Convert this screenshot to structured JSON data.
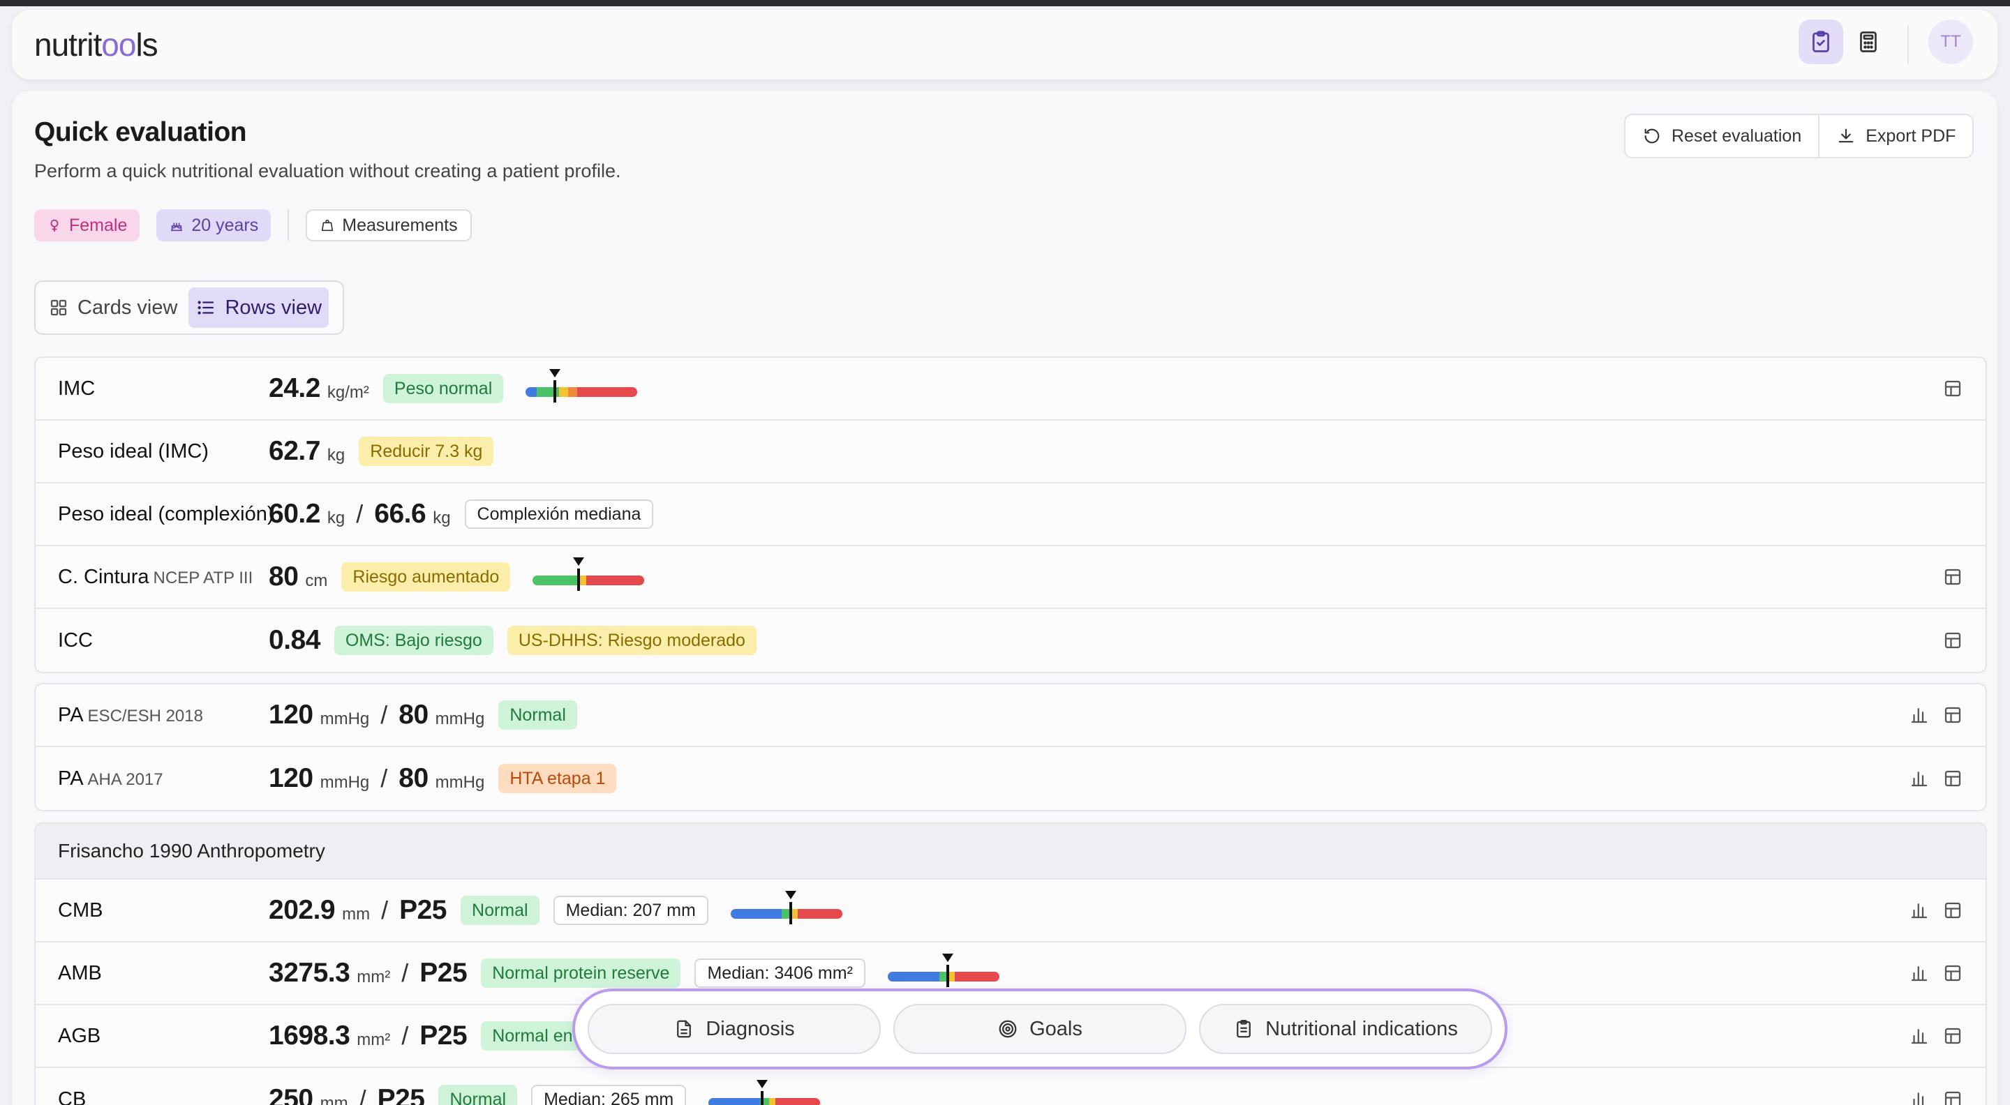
{
  "app": {
    "logo_prefix": "nutrit",
    "logo_oo": "oo",
    "logo_suffix": "ls",
    "avatar": "TT",
    "header_icons": [
      "clipboard-check-icon",
      "calculator-icon"
    ]
  },
  "page": {
    "title": "Quick evaluation",
    "subtitle": "Perform a quick nutritional evaluation without creating a patient profile.",
    "reset_label": "Reset evaluation",
    "export_label": "Export PDF"
  },
  "patient": {
    "sex": "Female",
    "age": "20 years",
    "measurements": "Measurements"
  },
  "views": {
    "cards": "Cards view",
    "rows": "Rows view",
    "active": "rows"
  },
  "colors": {
    "accent": "#8b6bd8",
    "green": "#4cc268",
    "yellow": "#f2c230",
    "orange": "#f08a3a",
    "red": "#e5484d",
    "blue": "#3f7be0"
  },
  "group1": [
    {
      "label": "IMC",
      "value": "24.2",
      "unit": "kg/m²",
      "tags": [
        {
          "text": "Peso normal",
          "color": "green"
        }
      ],
      "gauge": {
        "type": "bmi",
        "level": 0.26
      },
      "icons": [
        "table"
      ]
    },
    {
      "label": "Peso ideal (IMC)",
      "value": "62.7",
      "unit": "kg",
      "tags": [
        {
          "text": "Reducir 7.3 kg",
          "color": "yellow"
        }
      ]
    },
    {
      "label": "Peso ideal (complexión)",
      "value": "60.2",
      "unit": "kg",
      "value2": "66.6",
      "unit2": "kg",
      "tags": [
        {
          "text": "Complexión mediana",
          "color": "outline"
        }
      ]
    },
    {
      "label": "C. Cintura",
      "sublabel": "NCEP ATP III",
      "value": "80",
      "unit": "cm",
      "tags": [
        {
          "text": "Riesgo aumentado",
          "color": "yellow"
        }
      ],
      "gauge": {
        "type": "waist",
        "level": 0.41
      },
      "icons": [
        "table"
      ]
    },
    {
      "label": "ICC",
      "value": "0.84",
      "tags": [
        {
          "text": "OMS: Bajo riesgo",
          "color": "green"
        },
        {
          "text": "US-DHHS: Riesgo moderado",
          "color": "yellow"
        }
      ],
      "icons": [
        "table"
      ]
    }
  ],
  "group2": [
    {
      "label": "PA",
      "sublabel": "ESC/ESH 2018",
      "value": "120",
      "unit": "mmHg",
      "value2": "80",
      "unit2": "mmHg",
      "tags": [
        {
          "text": "Normal",
          "color": "green"
        }
      ],
      "icons": [
        "chart",
        "table"
      ]
    },
    {
      "label": "PA",
      "sublabel": "AHA 2017",
      "value": "120",
      "unit": "mmHg",
      "value2": "80",
      "unit2": "mmHg",
      "tags": [
        {
          "text": "HTA etapa 1",
          "color": "orange"
        }
      ],
      "icons": [
        "chart",
        "table"
      ]
    }
  ],
  "group3": {
    "title": "Frisancho 1990 Anthropometry",
    "rows": [
      {
        "label": "CMB",
        "value": "202.9",
        "unit": "mm",
        "value2": "P25",
        "tags": [
          {
            "text": "Normal",
            "color": "green"
          },
          {
            "text": "Median: 207 mm",
            "color": "outline"
          }
        ],
        "gauge": {
          "type": "percentile",
          "level": 0.54
        },
        "icons": [
          "chart",
          "table"
        ]
      },
      {
        "label": "AMB",
        "value": "3275.3",
        "unit": "mm²",
        "value2": "P25",
        "tags": [
          {
            "text": "Normal protein reserve",
            "color": "green"
          },
          {
            "text": "Median: 3406 mm²",
            "color": "outline"
          }
        ],
        "gauge": {
          "type": "percentile",
          "level": 0.54
        },
        "icons": [
          "chart",
          "table"
        ]
      },
      {
        "label": "AGB",
        "value": "1698.3",
        "unit": "mm²",
        "value2": "P25",
        "tags": [
          {
            "text": "Normal en",
            "color": "green"
          }
        ],
        "icons": [
          "chart",
          "table"
        ]
      },
      {
        "label": "CB",
        "value": "250",
        "unit": "mm",
        "value2": "P25",
        "tags": [
          {
            "text": "Normal",
            "color": "green"
          },
          {
            "text": "Median: 265 mm",
            "color": "outline"
          }
        ],
        "gauge": {
          "type": "percentile",
          "level": 0.48
        },
        "icons": [
          "chart",
          "table"
        ]
      }
    ]
  },
  "bottom_actions": {
    "diagnosis": "Diagnosis",
    "goals": "Goals",
    "indications": "Nutritional indications"
  }
}
